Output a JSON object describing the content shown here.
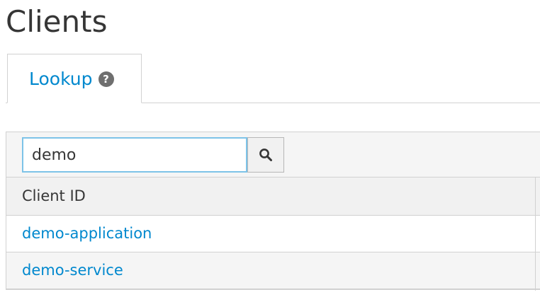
{
  "page": {
    "title": "Clients"
  },
  "tabs": [
    {
      "label": "Lookup",
      "help_icon": "question-circle-icon"
    }
  ],
  "search": {
    "value": "demo",
    "button_icon": "search-icon"
  },
  "table": {
    "columns": [
      "Client ID"
    ],
    "rows": [
      {
        "client_id": "demo-application"
      },
      {
        "client_id": "demo-service"
      }
    ]
  },
  "colors": {
    "link": "#0088ce",
    "text": "#363636",
    "border": "#d1d1d1",
    "input_focus_border": "#7dc3e8"
  }
}
